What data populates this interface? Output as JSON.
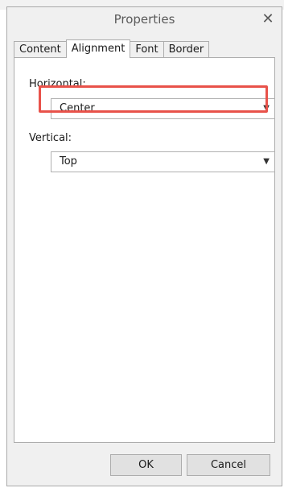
{
  "dialog": {
    "title": "Properties",
    "close_icon": "close-icon"
  },
  "tabs": [
    {
      "label": "Content",
      "active": false
    },
    {
      "label": "Alignment",
      "active": true
    },
    {
      "label": "Font",
      "active": false
    },
    {
      "label": "Border",
      "active": false
    }
  ],
  "alignment": {
    "horizontal_label": "Horizontal:",
    "horizontal_value": "Center",
    "vertical_label": "Vertical:",
    "vertical_value": "Top"
  },
  "buttons": {
    "ok_label": "OK",
    "cancel_label": "Cancel"
  },
  "colors": {
    "highlight": "#e8524a",
    "dialog_bg": "#f0f0f0",
    "panel_bg": "#ffffff",
    "button_bg": "#e1e1e1"
  }
}
